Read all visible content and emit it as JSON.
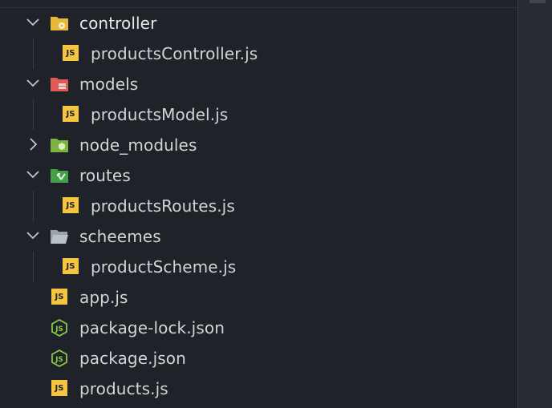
{
  "explorer": {
    "items": [
      {
        "label": "controller",
        "type": "folder",
        "expanded": true,
        "icon": "folder-controller-icon"
      },
      {
        "label": "productsController.js",
        "type": "file",
        "icon": "js-file-icon"
      },
      {
        "label": "models",
        "type": "folder",
        "expanded": true,
        "icon": "folder-models-icon"
      },
      {
        "label": "productsModel.js",
        "type": "file",
        "icon": "js-file-icon"
      },
      {
        "label": "node_modules",
        "type": "folder",
        "expanded": false,
        "icon": "folder-node-icon"
      },
      {
        "label": "routes",
        "type": "folder",
        "expanded": true,
        "icon": "folder-routes-icon"
      },
      {
        "label": "productsRoutes.js",
        "type": "file",
        "icon": "js-file-icon"
      },
      {
        "label": "scheemes",
        "type": "folder",
        "expanded": true,
        "icon": "folder-open-icon"
      },
      {
        "label": "productScheme.js",
        "type": "file",
        "icon": "js-file-icon"
      },
      {
        "label": "app.js",
        "type": "file",
        "icon": "js-file-icon"
      },
      {
        "label": "package-lock.json",
        "type": "file",
        "icon": "nodejs-icon"
      },
      {
        "label": "package.json",
        "type": "file",
        "icon": "nodejs-icon"
      },
      {
        "label": "products.js",
        "type": "file",
        "icon": "js-file-icon"
      }
    ]
  },
  "colors": {
    "background": "#1f2228",
    "text": "#d4d4d4",
    "js_yellow": "#f5c542",
    "folder_yellow": "#e8b83a",
    "folder_red": "#e05a5a",
    "folder_green": "#7cb342",
    "nodejs_green": "#8cc84b",
    "folder_grey": "#9aa3ad"
  }
}
